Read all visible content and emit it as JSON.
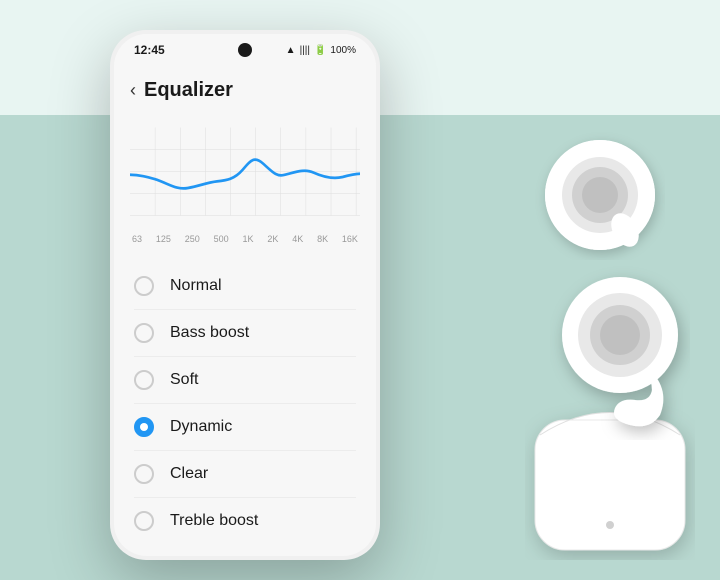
{
  "background": {
    "top_color": "#e8f5f2",
    "bottom_color": "#b8d8d0"
  },
  "status_bar": {
    "time": "12:45",
    "battery": "100%",
    "signal_icon": "signal-icon",
    "wifi_icon": "wifi-icon",
    "battery_icon": "battery-icon"
  },
  "header": {
    "back_label": "‹",
    "title": "Equalizer"
  },
  "chart": {
    "x_labels": [
      "63",
      "125",
      "250",
      "500",
      "1K",
      "2K",
      "4K",
      "8K",
      "16K"
    ]
  },
  "options": [
    {
      "id": "normal",
      "label": "Normal",
      "selected": false
    },
    {
      "id": "bass-boost",
      "label": "Bass boost",
      "selected": false
    },
    {
      "id": "soft",
      "label": "Soft",
      "selected": false
    },
    {
      "id": "dynamic",
      "label": "Dynamic",
      "selected": true
    },
    {
      "id": "clear",
      "label": "Clear",
      "selected": false
    },
    {
      "id": "treble-boost",
      "label": "Treble boost",
      "selected": false
    }
  ]
}
